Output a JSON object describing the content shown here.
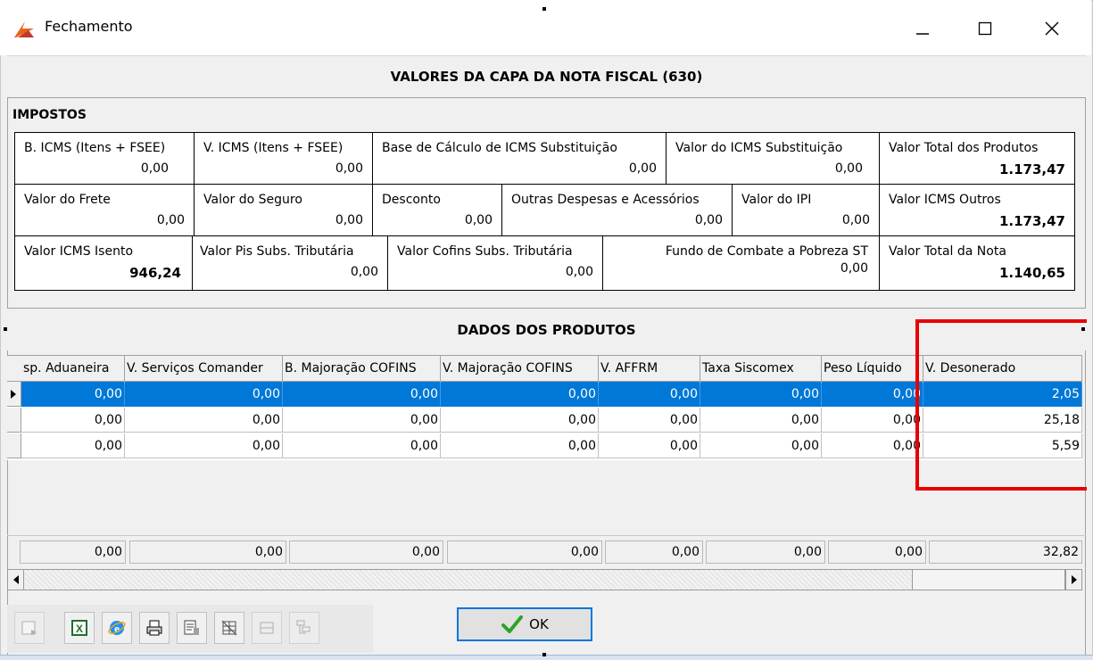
{
  "window": {
    "title": "Fechamento",
    "minimize_glyph": "—",
    "maximize_glyph": "☐",
    "close_glyph": "✕"
  },
  "header": {
    "title": "VALORES DA CAPA DA NOTA FISCAL (630)"
  },
  "impostos": {
    "label": "IMPOSTOS",
    "row1": [
      {
        "label": "B. ICMS (Itens + FSEE)",
        "value": "0,00"
      },
      {
        "label": "V. ICMS (Itens + FSEE)",
        "value": "0,00"
      },
      {
        "label": "Base de Cálculo de ICMS Substituição",
        "value": "0,00"
      },
      {
        "label": "Valor do ICMS Substituição",
        "value": "0,00"
      },
      {
        "label": "Valor Total dos Produtos",
        "value": "1.173,47"
      }
    ],
    "row2": [
      {
        "label": "Valor do Frete",
        "value": "0,00"
      },
      {
        "label": "Valor do Seguro",
        "value": "0,00"
      },
      {
        "label": "Desconto",
        "value": "0,00"
      },
      {
        "label": "Outras Despesas e Acessórios",
        "value": "0,00"
      },
      {
        "label": "Valor do IPI",
        "value": "0,00"
      },
      {
        "label": "Valor ICMS Outros",
        "value": "1.173,47"
      }
    ],
    "row3": [
      {
        "label": "Valor ICMS Isento",
        "value": "946,24"
      },
      {
        "label": "Valor Pis Subs. Tributária",
        "value": "0,00"
      },
      {
        "label": "Valor Cofins Subs. Tributária",
        "value": "0,00"
      },
      {
        "label": "Fundo de Combate a Pobreza ST",
        "value": "0,00"
      },
      {
        "label": "Valor Total da Nota",
        "value": "1.140,65"
      }
    ]
  },
  "produtos": {
    "title": "DADOS DOS PRODUTOS",
    "columns": [
      "sp. Aduaneira",
      "V. Serviços Comander",
      "B. Majoração COFINS",
      "V. Majoração COFINS",
      "V. AFFRM",
      "Taxa Siscomex",
      "Peso Líquido",
      "V. Desonerado"
    ],
    "rows": [
      [
        "0,00",
        "0,00",
        "0,00",
        "0,00",
        "0,00",
        "0,00",
        "0,00",
        "2,05"
      ],
      [
        "0,00",
        "0,00",
        "0,00",
        "0,00",
        "0,00",
        "0,00",
        "0,00",
        "25,18"
      ],
      [
        "0,00",
        "0,00",
        "0,00",
        "0,00",
        "0,00",
        "0,00",
        "0,00",
        "5,59"
      ]
    ],
    "totals": [
      "0,00",
      "0,00",
      "0,00",
      "0,00",
      "0,00",
      "0,00",
      "0,00",
      "32,82"
    ],
    "selected_row": 0,
    "highlight_color": "#e80000",
    "selection_color": "#0078d7"
  },
  "toolbar": {
    "icons": [
      "export-icon",
      "excel-icon",
      "ie-icon",
      "print-icon",
      "print-preview-icon",
      "grid-config-icon",
      "columns-icon",
      "tree-icon"
    ]
  },
  "ok_button": {
    "label": "OK"
  }
}
